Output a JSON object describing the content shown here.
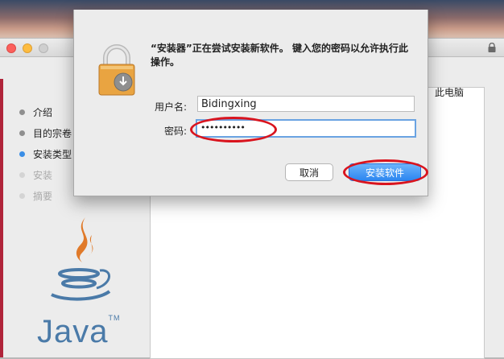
{
  "dialog": {
    "message": "“安装器”正在尝试安装新软件。 键入您的密码以允许执行此操作。",
    "username_label": "用户名:",
    "username_value": "Bidingxing",
    "password_label": "密码:",
    "password_value": "••••••••••",
    "cancel_label": "取消",
    "install_label": "安装软件"
  },
  "installer": {
    "steps": [
      {
        "label": "介绍",
        "state": "done"
      },
      {
        "label": "目的宗卷",
        "state": "done"
      },
      {
        "label": "安装类型",
        "state": "active"
      },
      {
        "label": "安装",
        "state": "pending"
      },
      {
        "label": "摘要",
        "state": "pending"
      }
    ],
    "content_text": "此电脑",
    "logo_text": "Java",
    "logo_tm": "TM"
  },
  "colors": {
    "accent": "#2c86f0",
    "annotation": "#d9141e",
    "active_step": "#3a8ee6"
  },
  "icons": [
    "lock-icon",
    "java-logo-icon"
  ]
}
